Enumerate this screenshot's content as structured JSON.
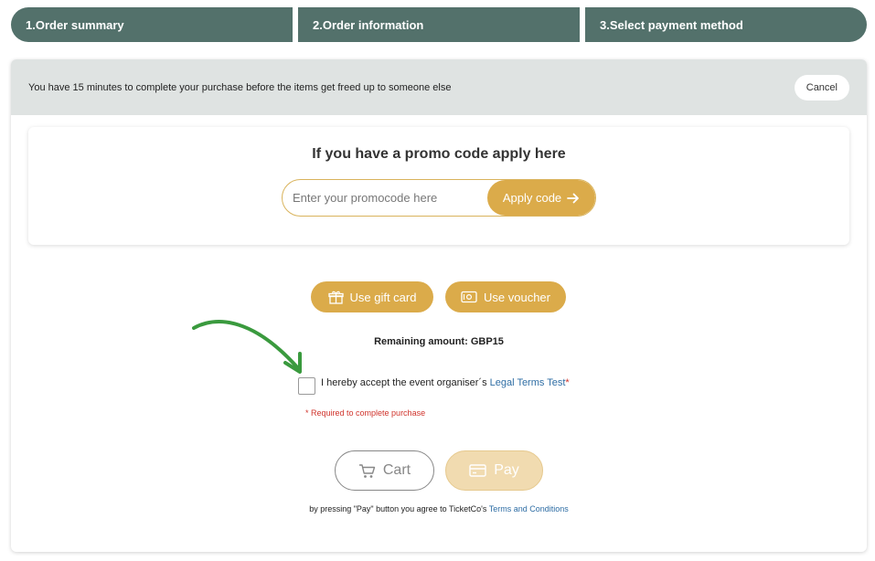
{
  "steps": [
    {
      "label": "1.Order summary"
    },
    {
      "label": "2.Order information"
    },
    {
      "label": "3.Select payment method"
    }
  ],
  "timer": {
    "message": "You have 15 minutes to complete your purchase before the items get freed up to someone else",
    "cancel_label": "Cancel"
  },
  "promo": {
    "title": "If you have a promo code apply here",
    "placeholder": "Enter your promocode here",
    "input_value": "",
    "apply_label": "Apply code"
  },
  "payment_options": {
    "gift_card_label": "Use gift card",
    "voucher_label": "Use voucher"
  },
  "remaining": {
    "text": "Remaining amount: GBP15"
  },
  "terms": {
    "prefix": "I hereby accept the event organiser´s ",
    "link_label": "Legal Terms Test",
    "asterisk": "*",
    "required_note": "*  Required to complete purchase"
  },
  "actions": {
    "cart_label": "Cart",
    "pay_label": "Pay"
  },
  "footer": {
    "prefix": "by pressing \"Pay\" button you agree to TicketCo's ",
    "link_label": "Terms and Conditions"
  },
  "colors": {
    "step_bg": "#53716b",
    "accent_gold": "#dbab4a",
    "pay_disabled": "#f1dbb0",
    "link": "#2e6da4",
    "required": "#d0342c",
    "annotation_arrow": "#3a9a3e"
  }
}
